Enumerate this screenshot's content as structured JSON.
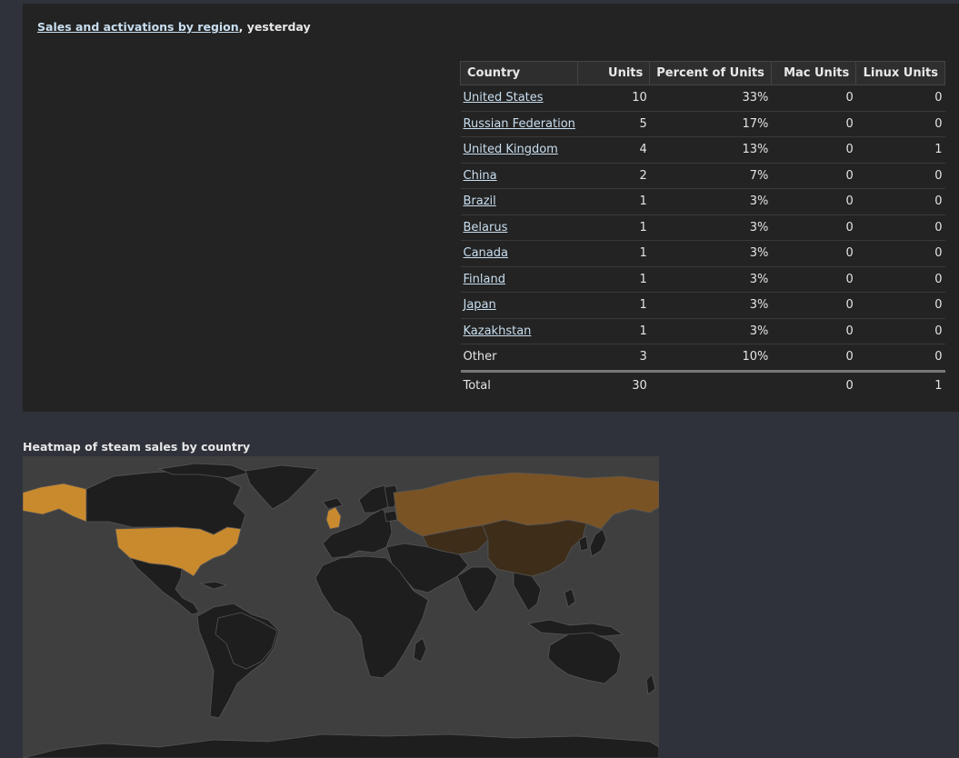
{
  "sales_panel": {
    "title_link": "Sales and activations by region",
    "title_suffix": ", yesterday",
    "columns": {
      "country": "Country",
      "units": "Units",
      "percent": "Percent of Units",
      "mac": "Mac Units",
      "linux": "Linux Units"
    },
    "rows": [
      {
        "country": "United States",
        "units": "10",
        "percent": "33%",
        "mac": "0",
        "linux": "0"
      },
      {
        "country": "Russian Federation",
        "units": "5",
        "percent": "17%",
        "mac": "0",
        "linux": "0"
      },
      {
        "country": "United Kingdom",
        "units": "4",
        "percent": "13%",
        "mac": "0",
        "linux": "1"
      },
      {
        "country": "China",
        "units": "2",
        "percent": "7%",
        "mac": "0",
        "linux": "0"
      },
      {
        "country": "Brazil",
        "units": "1",
        "percent": "3%",
        "mac": "0",
        "linux": "0"
      },
      {
        "country": "Belarus",
        "units": "1",
        "percent": "3%",
        "mac": "0",
        "linux": "0"
      },
      {
        "country": "Canada",
        "units": "1",
        "percent": "3%",
        "mac": "0",
        "linux": "0"
      },
      {
        "country": "Finland",
        "units": "1",
        "percent": "3%",
        "mac": "0",
        "linux": "0"
      },
      {
        "country": "Japan",
        "units": "1",
        "percent": "3%",
        "mac": "0",
        "linux": "0"
      },
      {
        "country": "Kazakhstan",
        "units": "1",
        "percent": "3%",
        "mac": "0",
        "linux": "0"
      }
    ],
    "other": {
      "country": "Other",
      "units": "3",
      "percent": "10%",
      "mac": "0",
      "linux": "0"
    },
    "total": {
      "country": "Total",
      "units": "30",
      "percent": "",
      "mac": "0",
      "linux": "1"
    }
  },
  "heatmap": {
    "title": "Heatmap of steam sales by country",
    "colors": {
      "ocean": "#3f3f3f",
      "land": "#1e1e1e",
      "border": "#555555",
      "high": "#c98a2e",
      "medium": "#7a5325",
      "low": "#3d2d19"
    }
  }
}
